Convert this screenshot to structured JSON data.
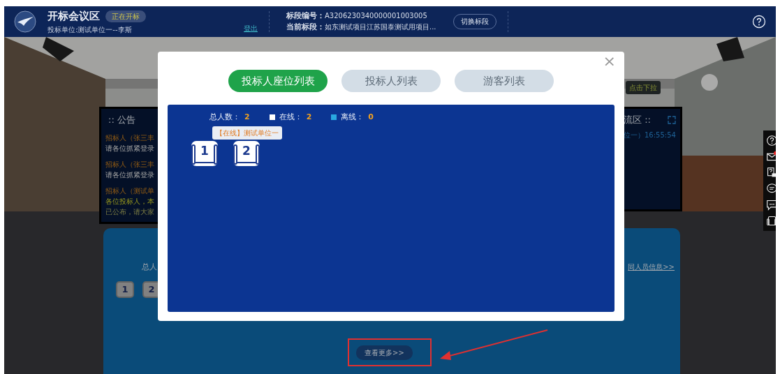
{
  "header": {
    "title": "开标会议区",
    "status_badge": "正在开标",
    "bidder": "投标单位:测试单位一--李斯",
    "logout": "登出",
    "section_code_label": "标段编号：",
    "section_code": "A3206230340000001003005",
    "current_section_label": "当前标段：",
    "current_section": "如东测试项目江苏国泰测试用项目...",
    "switch_button": "切换标段"
  },
  "announcement_panel": {
    "title": ":: 公告",
    "messages": [
      {
        "sender": "招标人（张三丰",
        "lines": [
          "请各位抓紧登录"
        ]
      },
      {
        "sender": "招标人（张三丰",
        "lines": [
          "请各位抓紧登录"
        ]
      },
      {
        "sender": "招标人（测试单",
        "lines": [
          "各位投标人，本",
          "已公布，请大家"
        ]
      }
    ]
  },
  "chat_panel": {
    "title": "流区 ::",
    "messages": [
      "位一）16:55:54"
    ]
  },
  "dropdown_hint": "点击下拉",
  "seat_panel": {
    "total_label": "总人",
    "seats": [
      {
        "number": "1"
      },
      {
        "number": "2"
      }
    ],
    "member_info_link": "同人员信息>>",
    "more_button": "查看更多>>"
  },
  "side_toolbar": [
    {
      "kind": "help",
      "unread": false
    },
    {
      "kind": "mail",
      "unread": true
    },
    {
      "kind": "faq",
      "unread": false
    },
    {
      "kind": "comment",
      "unread": false
    },
    {
      "kind": "chat",
      "unread": false
    },
    {
      "kind": "seat",
      "unread": false
    }
  ],
  "modal": {
    "close_button": "×",
    "tabs": [
      {
        "label": "投标人座位列表",
        "selected": true
      },
      {
        "label": "投标人列表",
        "selected": false
      },
      {
        "label": "游客列表",
        "selected": false
      }
    ],
    "summary": {
      "total_label": "总人数：",
      "total": "2",
      "online_label": "在线：",
      "online": "2",
      "offline_label": "离线：",
      "offline": "0"
    },
    "seats": [
      {
        "number": "1",
        "online": true
      },
      {
        "number": "2",
        "online": true,
        "tooltip": "【在线】测试单位一"
      }
    ]
  }
}
